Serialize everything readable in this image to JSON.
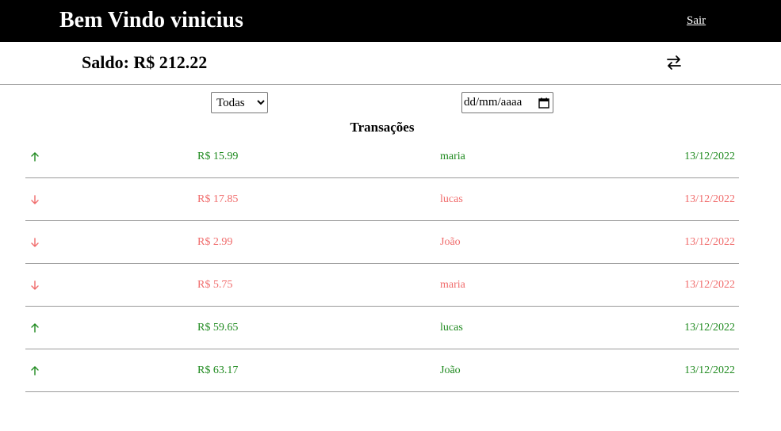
{
  "header": {
    "title": "Bem Vindo vinicius",
    "logout_label": "Sair"
  },
  "balance": {
    "text": "Saldo: R$ 212.22",
    "transfer_icon": "transfer-arrows-icon"
  },
  "filters": {
    "type_selected": "Todas",
    "date_placeholder": "dd/mm/aaaa"
  },
  "transactions": {
    "title": "Transações",
    "rows": [
      {
        "direction": "in",
        "amount": "R$ 15.99",
        "name": "maria",
        "date": "13/12/2022"
      },
      {
        "direction": "out",
        "amount": "R$ 17.85",
        "name": "lucas",
        "date": "13/12/2022"
      },
      {
        "direction": "out",
        "amount": "R$ 2.99",
        "name": "João",
        "date": "13/12/2022"
      },
      {
        "direction": "out",
        "amount": "R$ 5.75",
        "name": "maria",
        "date": "13/12/2022"
      },
      {
        "direction": "in",
        "amount": "R$ 59.65",
        "name": "lucas",
        "date": "13/12/2022"
      },
      {
        "direction": "in",
        "amount": "R$ 63.17",
        "name": "João",
        "date": "13/12/2022"
      }
    ]
  },
  "colors": {
    "header_bg": "#000000",
    "income": "#1f8a1f",
    "expense": "#f06b6b"
  }
}
